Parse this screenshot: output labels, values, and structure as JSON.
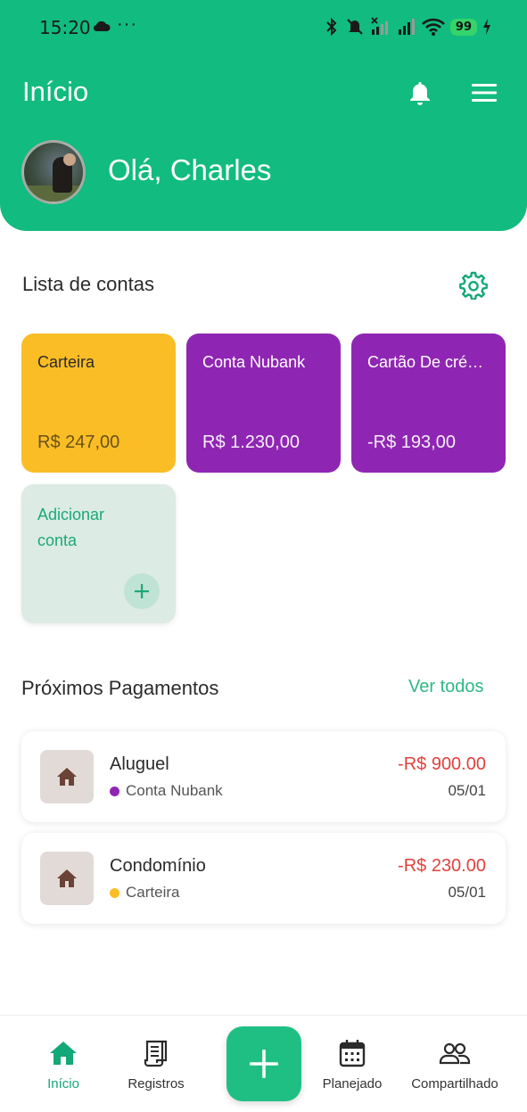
{
  "status_bar": {
    "time": "15:20",
    "more": "···",
    "battery": "99"
  },
  "header": {
    "title": "Início",
    "greeting": "Olá, Charles"
  },
  "accounts": {
    "section_title": "Lista de contas",
    "items": [
      {
        "name": "Carteira",
        "balance": "R$ 247,00",
        "color": "#fbbd26"
      },
      {
        "name": "Conta Nubank",
        "balance": "R$ 1.230,00",
        "color": "#8f26b3"
      },
      {
        "name": "Cartão De crédito",
        "balance": "-R$ 193,00",
        "color": "#8f26b3"
      }
    ],
    "add_label": "Adicionar conta"
  },
  "payments": {
    "section_title": "Próximos Pagamentos",
    "see_all": "Ver todos",
    "items": [
      {
        "name": "Aluguel",
        "account": "Conta Nubank",
        "account_color": "#8f26b3",
        "amount": "-R$ 900.00",
        "date": "05/01",
        "icon": "home-icon"
      },
      {
        "name": "Condomínio",
        "account": "Carteira",
        "account_color": "#fbbd26",
        "amount": "-R$ 230.00",
        "date": "05/01",
        "icon": "home-icon"
      }
    ]
  },
  "nav": {
    "items": [
      {
        "label": "Início",
        "icon": "home-icon",
        "active": true
      },
      {
        "label": "Registros",
        "icon": "receipt-icon"
      },
      {
        "label": "Planejado",
        "icon": "calendar-icon"
      },
      {
        "label": "Compartilhado",
        "icon": "people-icon"
      }
    ],
    "fab_icon": "plus-icon"
  },
  "colors": {
    "primary": "#12bb80",
    "negative": "#e0423c"
  }
}
